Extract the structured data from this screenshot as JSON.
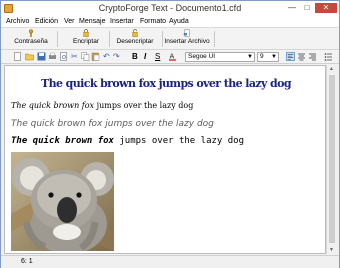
{
  "window": {
    "title": "CryptoForge Text - Documento1.cfd",
    "min": "—",
    "max": "□",
    "close": "✕"
  },
  "menu": {
    "items": [
      "Archivo",
      "Edición",
      "Ver",
      "Mensaje",
      "Insertar",
      "Formato",
      "Ayuda"
    ]
  },
  "commands": {
    "password": "Contraseña",
    "encrypt": "Encriptar",
    "decrypt": "Desencriptar",
    "insert_file": "Insertar Archivo"
  },
  "format": {
    "cut": "✂",
    "undo": "↶",
    "redo": "↷",
    "bold": "B",
    "italic": "I",
    "underline": "S",
    "font": "Segoe UI",
    "size": "9"
  },
  "document": {
    "title_line": "The quick brown fox jumps over the lazy dog",
    "line2_italic": "The quick brown fox",
    "line2_regular": " jumps over the lazy dog",
    "line3": "The quick brown fox jumps over the lazy dog",
    "line4_bold": "The quick brown fox",
    "line4_regular": " jumps over the lazy dog"
  },
  "status": {
    "position": "6:  1"
  },
  "colors": {
    "title_text": "#1a237e",
    "close_button": "#c9483e"
  },
  "icons": {
    "password": "key-icon",
    "encrypt": "lock-icon",
    "decrypt": "unlock-icon",
    "insert_file": "file-insert-icon"
  }
}
